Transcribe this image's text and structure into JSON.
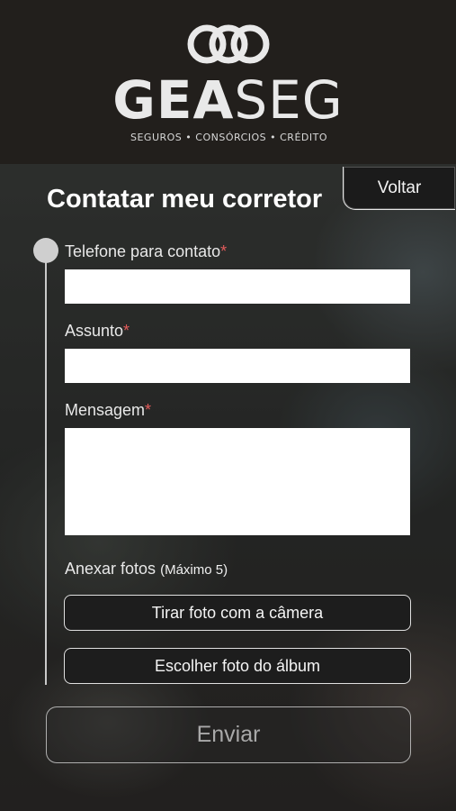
{
  "brand": {
    "name_bold": "GEA",
    "name_regular": "SEG",
    "tagline": "SEGUROS • CONSÓRCIOS • CRÉDITO",
    "logo_icon": "interlocked-rings-icon"
  },
  "header": {
    "back_label": "Voltar",
    "title": "Contatar meu corretor"
  },
  "form": {
    "phone": {
      "label": "Telefone para contato",
      "required_mark": "*",
      "value": ""
    },
    "subject": {
      "label": "Assunto",
      "required_mark": "*",
      "value": ""
    },
    "message": {
      "label": "Mensagem",
      "required_mark": "*",
      "value": ""
    },
    "attach": {
      "label": "Anexar fotos",
      "limit": "(Máximo 5)",
      "camera_button": "Tirar foto com a câmera",
      "album_button": "Escolher foto do álbum"
    },
    "submit_label": "Enviar"
  },
  "colors": {
    "header_bg": "#221f1c",
    "required": "#e25b5b",
    "submit_text_disabled": "#a9a9a9"
  }
}
